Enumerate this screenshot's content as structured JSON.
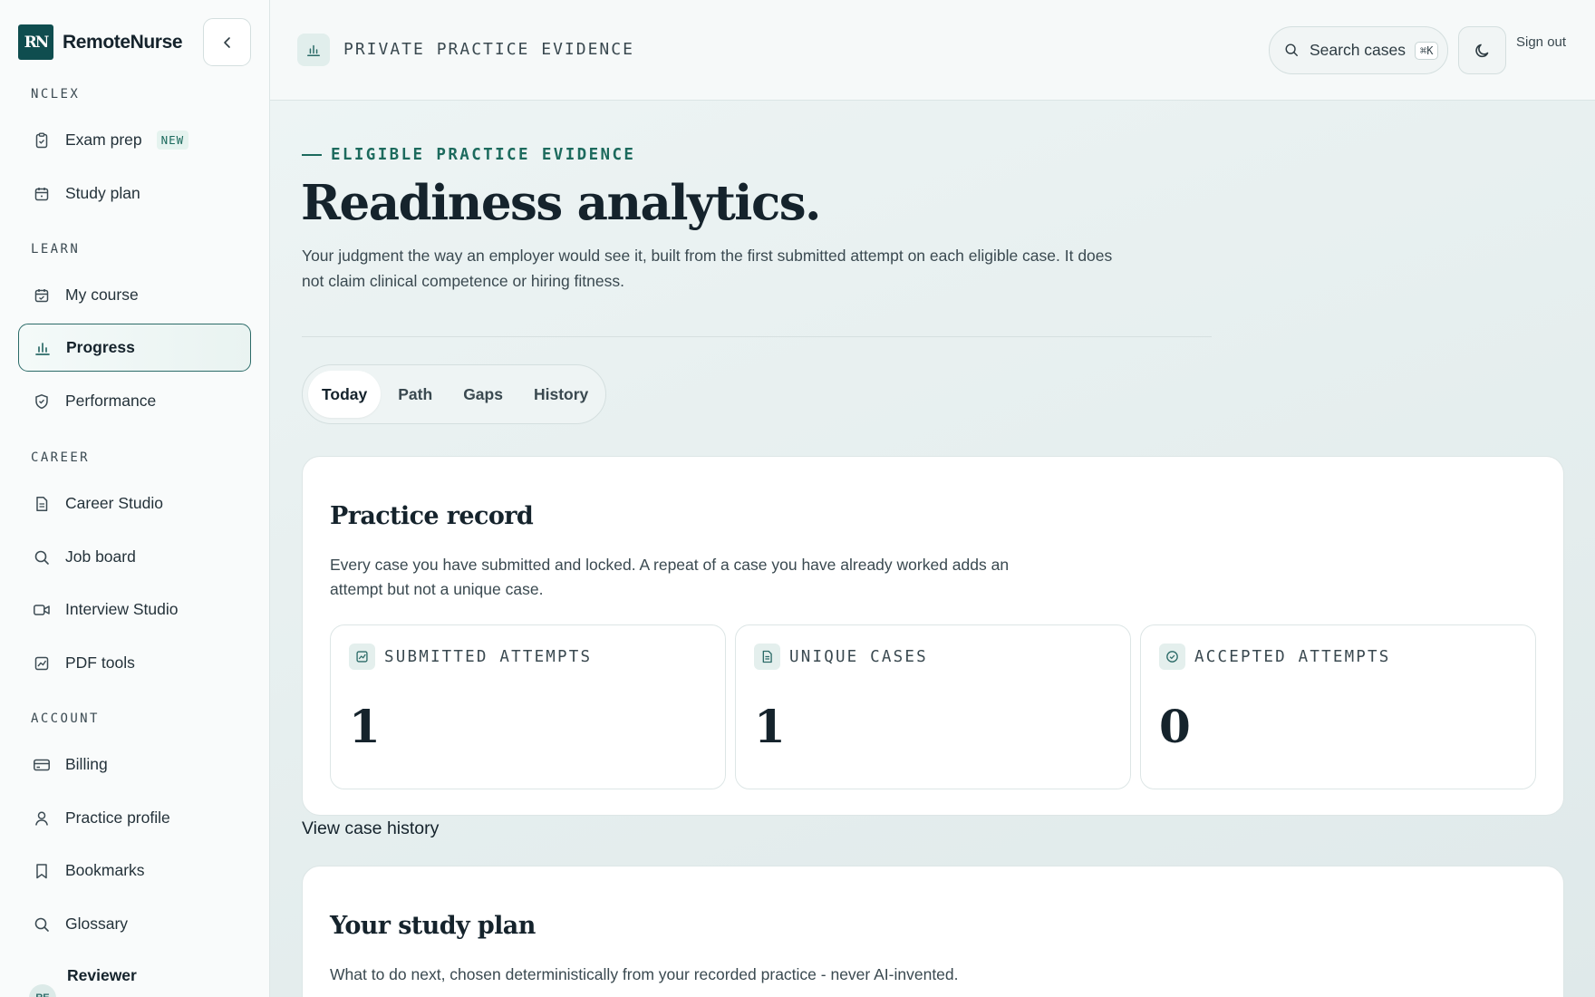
{
  "brand": {
    "name": "RemoteNurse",
    "logo_text": "RN"
  },
  "sidebar": {
    "sections": [
      {
        "label": "NCLEX"
      },
      {
        "label": "LEARN"
      },
      {
        "label": "CAREER"
      },
      {
        "label": "ACCOUNT"
      }
    ],
    "items": [
      {
        "label": "Exam prep",
        "icon": "clipboard-check-icon",
        "badge": "NEW"
      },
      {
        "label": "Study plan",
        "icon": "calendar-icon"
      },
      {
        "label": "My course",
        "icon": "calendar-check-icon"
      },
      {
        "label": "Progress",
        "icon": "bar-chart-icon",
        "active": true
      },
      {
        "label": "Performance",
        "icon": "shield-icon"
      },
      {
        "label": "Career Studio",
        "icon": "document-icon"
      },
      {
        "label": "Job board",
        "icon": "search-icon"
      },
      {
        "label": "Interview Studio",
        "icon": "video-camera-icon"
      },
      {
        "label": "PDF tools",
        "icon": "chart-line-icon"
      },
      {
        "label": "Billing",
        "icon": "credit-card-icon"
      },
      {
        "label": "Practice profile",
        "icon": "user-icon"
      },
      {
        "label": "Bookmarks",
        "icon": "bookmark-icon"
      },
      {
        "label": "Glossary",
        "icon": "search-icon"
      }
    ],
    "user": {
      "name": "Reviewer",
      "initials": "RE"
    }
  },
  "topbar": {
    "breadcrumb": "PRIVATE PRACTICE EVIDENCE",
    "search_label": "Search cases",
    "search_shortcut": "⌘K",
    "signout_label": "Sign out"
  },
  "hero": {
    "eyebrow": "ELIGIBLE PRACTICE EVIDENCE",
    "title": "Readiness analytics.",
    "description": "Your judgment the way an employer would see it, built from the first submitted attempt on each eligible case. It does not claim clinical competence or hiring fitness."
  },
  "tabs": [
    {
      "label": "Today",
      "active": true
    },
    {
      "label": "Path"
    },
    {
      "label": "Gaps"
    },
    {
      "label": "History"
    }
  ],
  "practice_record": {
    "title": "Practice record",
    "description": "Every case you have submitted and locked. A repeat of a case you have already worked adds an attempt but not a unique case.",
    "stats": [
      {
        "label": "SUBMITTED ATTEMPTS",
        "value": "1",
        "icon": "chart-square-icon"
      },
      {
        "label": "UNIQUE CASES",
        "value": "1",
        "icon": "document-icon"
      },
      {
        "label": "ACCEPTED ATTEMPTS",
        "value": "0",
        "icon": "check-circle-icon"
      }
    ]
  },
  "view_history_link": "View case history",
  "study_plan": {
    "title": "Your study plan",
    "description": "What to do next, chosen deterministically from your recorded practice - never AI-invented."
  },
  "colors": {
    "accent": "#1c6a5d",
    "brand": "#0f4d4f",
    "active_border": "#2c6b68"
  }
}
